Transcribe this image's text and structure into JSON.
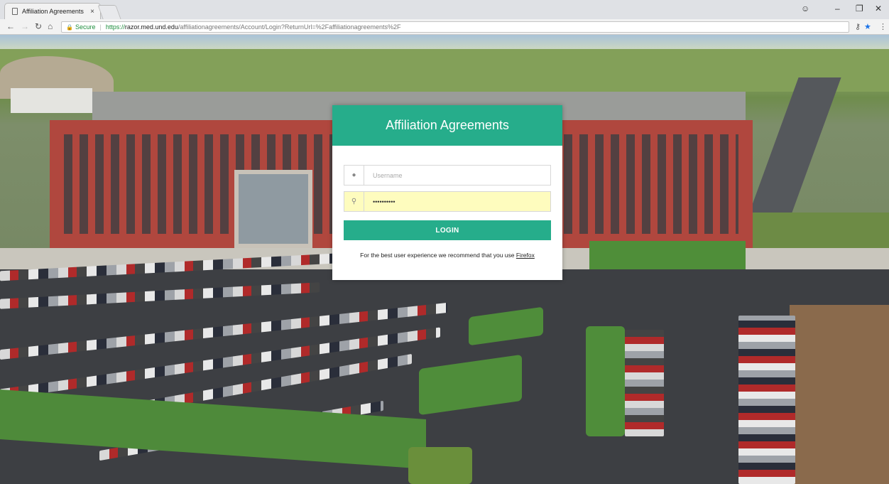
{
  "browser": {
    "tab_title": "Affiliation Agreements",
    "tab_close": "×",
    "url_scheme": "https://",
    "url_host": "razor.med.und.edu",
    "url_path": "/affiliationagreements/Account/Login?ReturnUrl=%2Faffiliationagreements%2F",
    "secure_label": "Secure"
  },
  "login": {
    "title": "Affiliation Agreements",
    "username_placeholder": "Username",
    "password_value": "••••••••••",
    "login_button": "LOGIN",
    "note_prefix": "For the best user experience we recommend that you use ",
    "note_link": "Firefox"
  },
  "colors": {
    "accent": "#26ad8b",
    "autofill": "#fefcbe"
  },
  "icons": {
    "username": "user-icon",
    "password": "key-icon"
  }
}
